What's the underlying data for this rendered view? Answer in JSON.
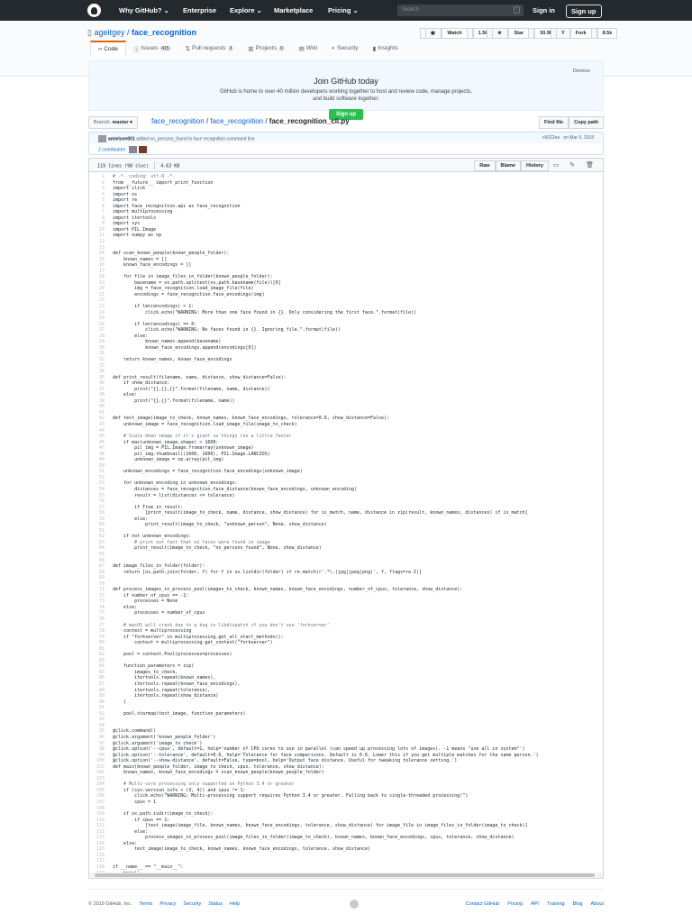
{
  "header": {
    "nav": [
      "Why GitHub? ⌄",
      "Enterprise",
      "Explore ⌄",
      "Marketplace",
      "Pricing ⌄"
    ],
    "search_placeholder": "Search",
    "search_shortcut": "/",
    "sign_in": "Sign in",
    "sign_up": "Sign up"
  },
  "repo": {
    "owner": "ageitgey",
    "name": "face_recognition",
    "watch_label": "Watch",
    "watch_count": "1.5k",
    "star_label": "Star",
    "star_count": "30.9k",
    "fork_label": "Fork",
    "fork_count": "8.5k",
    "tabs": [
      {
        "label": "Code",
        "icon": "code-icon"
      },
      {
        "label": "Issues",
        "count": "415",
        "icon": "issue-icon"
      },
      {
        "label": "Pull requests",
        "count": "3",
        "icon": "pr-icon"
      },
      {
        "label": "Projects",
        "count": "0",
        "icon": "project-icon"
      },
      {
        "label": "Wiki",
        "icon": "book-icon"
      },
      {
        "label": "Security",
        "icon": "shield-icon"
      },
      {
        "label": "Insights",
        "icon": "graph-icon"
      }
    ]
  },
  "banner": {
    "title": "Join GitHub today",
    "text": "GitHub is home to over 40 million developers working together to host and review code, manage projects, and build software together.",
    "button": "Sign up",
    "dismiss": "Dismiss"
  },
  "breadcrumb": {
    "branch_label": "Branch:",
    "branch": "master ▾",
    "parts": [
      "face_recognition",
      "face_recognition"
    ],
    "file": "face_recognition_cli.py",
    "find_file": "Find file",
    "copy_path": "Copy path"
  },
  "commit": {
    "author": "amielsen001",
    "message": "added no_persons_found to face recognition command line",
    "sha": "c6022ea",
    "date": "on Mar 9, 2018",
    "contributors": "2 contributors"
  },
  "file": {
    "lines_info": "119 lines (98 sloc)",
    "size": "4.63 KB",
    "raw": "Raw",
    "blame": "Blame",
    "history": "History",
    "code": [
      "# -*- coding: utf-8 -*-",
      "from __future__ import print_function",
      "import click",
      "import os",
      "import re",
      "import face_recognition.api as face_recognition",
      "import multiprocessing",
      "import itertools",
      "import sys",
      "import PIL.Image",
      "import numpy as np",
      "",
      "",
      "def scan_known_people(known_people_folder):",
      "    known_names = []",
      "    known_face_encodings = []",
      "",
      "    for file in image_files_in_folder(known_people_folder):",
      "        basename = os.path.splitext(os.path.basename(file))[0]",
      "        img = face_recognition.load_image_file(file)",
      "        encodings = face_recognition.face_encodings(img)",
      "",
      "        if len(encodings) > 1:",
      "            click.echo(\"WARNING: More than one face found in {}. Only considering the first face.\".format(file))",
      "",
      "        if len(encodings) == 0:",
      "            click.echo(\"WARNING: No faces found in {}. Ignoring file.\".format(file))",
      "        else:",
      "            known_names.append(basename)",
      "            known_face_encodings.append(encodings[0])",
      "",
      "    return known_names, known_face_encodings",
      "",
      "",
      "def print_result(filename, name, distance, show_distance=False):",
      "    if show_distance:",
      "        print(\"{},{},{}\".format(filename, name, distance))",
      "    else:",
      "        print(\"{},{}\".format(filename, name))",
      "",
      "",
      "def test_image(image_to_check, known_names, known_face_encodings, tolerance=0.6, show_distance=False):",
      "    unknown_image = face_recognition.load_image_file(image_to_check)",
      "",
      "    # Scale down image if it's giant so things run a little faster",
      "    if max(unknown_image.shape) > 1600:",
      "        pil_img = PIL.Image.fromarray(unknown_image)",
      "        pil_img.thumbnail((1600, 1600), PIL.Image.LANCZOS)",
      "        unknown_image = np.array(pil_img)",
      "",
      "    unknown_encodings = face_recognition.face_encodings(unknown_image)",
      "",
      "    for unknown_encoding in unknown_encodings:",
      "        distances = face_recognition.face_distance(known_face_encodings, unknown_encoding)",
      "        result = list(distances <= tolerance)",
      "",
      "        if True in result:",
      "            [print_result(image_to_check, name, distance, show_distance) for is_match, name, distance in zip(result, known_names, distances) if is_match]",
      "        else:",
      "            print_result(image_to_check, \"unknown_person\", None, show_distance)",
      "",
      "    if not unknown_encodings:",
      "        # print out fact that no faces were found in image",
      "        print_result(image_to_check, \"no_persons_found\", None, show_distance)",
      "",
      "",
      "def image_files_in_folder(folder):",
      "    return [os.path.join(folder, f) for f in os.listdir(folder) if re.match(r'.*\\.(jpg|jpeg|png)', f, flags=re.I)]",
      "",
      "",
      "def process_images_in_process_pool(images_to_check, known_names, known_face_encodings, number_of_cpus, tolerance, show_distance):",
      "    if number_of_cpus == -1:",
      "        processes = None",
      "    else:",
      "        processes = number_of_cpus",
      "",
      "    # macOS will crash due to a bug in libdispatch if you don't use 'forkserver'",
      "    context = multiprocessing",
      "    if \"forkserver\" in multiprocessing.get_all_start_methods():",
      "        context = multiprocessing.get_context(\"forkserver\")",
      "",
      "    pool = context.Pool(processes=processes)",
      "",
      "    function_parameters = zip(",
      "        images_to_check,",
      "        itertools.repeat(known_names),",
      "        itertools.repeat(known_face_encodings),",
      "        itertools.repeat(tolerance),",
      "        itertools.repeat(show_distance)",
      "    )",
      "",
      "    pool.starmap(test_image, function_parameters)",
      "",
      "",
      "@click.command()",
      "@click.argument('known_people_folder')",
      "@click.argument('image_to_check')",
      "@click.option('--cpus', default=1, help='number of CPU cores to use in parallel (can speed up processing lots of images). -1 means \"use all in system\"')",
      "@click.option('--tolerance', default=0.6, help='Tolerance for face comparisons. Default is 0.6. Lower this if you get multiple matches for the same person.')",
      "@click.option('--show-distance', default=False, type=bool, help='Output face distance. Useful for tweaking tolerance setting.')",
      "def main(known_people_folder, image_to_check, cpus, tolerance, show_distance):",
      "    known_names, known_face_encodings = scan_known_people(known_people_folder)",
      "",
      "    # Multi-core processing only supported on Python 3.4 or greater",
      "    if (sys.version_info < (3, 4)) and cpus != 1:",
      "        click.echo(\"WARNING: Multi-processing support requires Python 3.4 or greater. Falling back to single-threaded processing!\")",
      "        cpus = 1",
      "",
      "    if os.path.isdir(image_to_check):",
      "        if cpus == 1:",
      "            [test_image(image_file, known_names, known_face_encodings, tolerance, show_distance) for image_file in image_files_in_folder(image_to_check)]",
      "        else:",
      "            process_images_in_process_pool(image_files_in_folder(image_to_check), known_names, known_face_encodings, cpus, tolerance, show_distance)",
      "    else:",
      "        test_image(image_to_check, known_names, known_face_encodings, tolerance, show_distance)",
      "",
      "",
      "if __name__ == \"__main__\":",
      "    main()"
    ]
  },
  "footer": {
    "copyright": "© 2019 GitHub, Inc.",
    "left_links": [
      "Terms",
      "Privacy",
      "Security",
      "Status",
      "Help"
    ],
    "right_links": [
      "Contact GitHub",
      "Pricing",
      "API",
      "Training",
      "Blog",
      "About"
    ]
  }
}
